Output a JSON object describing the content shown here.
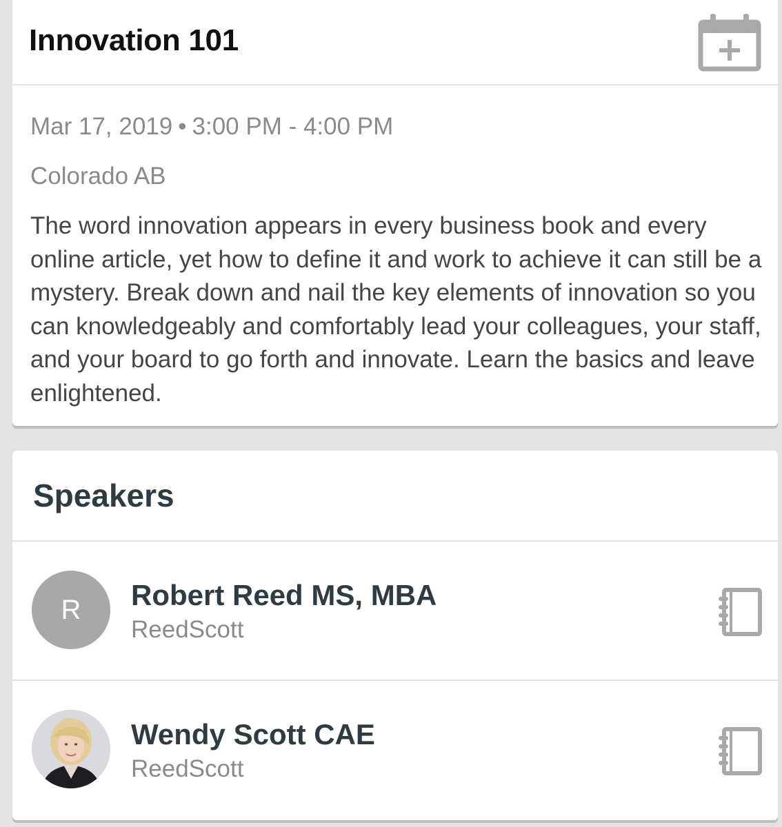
{
  "session": {
    "title": "Innovation 101",
    "date": "Mar 17, 2019",
    "separator": "•",
    "time": "3:00 PM - 4:00 PM",
    "location": "Colorado AB",
    "description": "The word innovation appears in every business book and every online article, yet how to define it and work to achieve it can still be a mystery. Break down and nail the key elements of innovation so you can knowledgeably and comfortably lead your colleagues, your staff, and your board to go forth and innovate. Learn the basics and leave enlightened.",
    "calendar_icon": "calendar-add-icon"
  },
  "speakers": {
    "heading": "Speakers",
    "items": [
      {
        "initial": "R",
        "name": "Robert Reed MS, MBA",
        "organization": "ReedScott",
        "avatar": "initial",
        "action_icon": "notebook-icon"
      },
      {
        "initial": "",
        "name": "Wendy Scott CAE",
        "organization": "ReedScott",
        "avatar": "photo",
        "action_icon": "notebook-icon"
      }
    ]
  },
  "colors": {
    "background": "#e3e3e3",
    "card": "#ffffff",
    "heading": "#2f3b42",
    "muted": "#8a8a8a",
    "icon": "#a9a9a9"
  }
}
